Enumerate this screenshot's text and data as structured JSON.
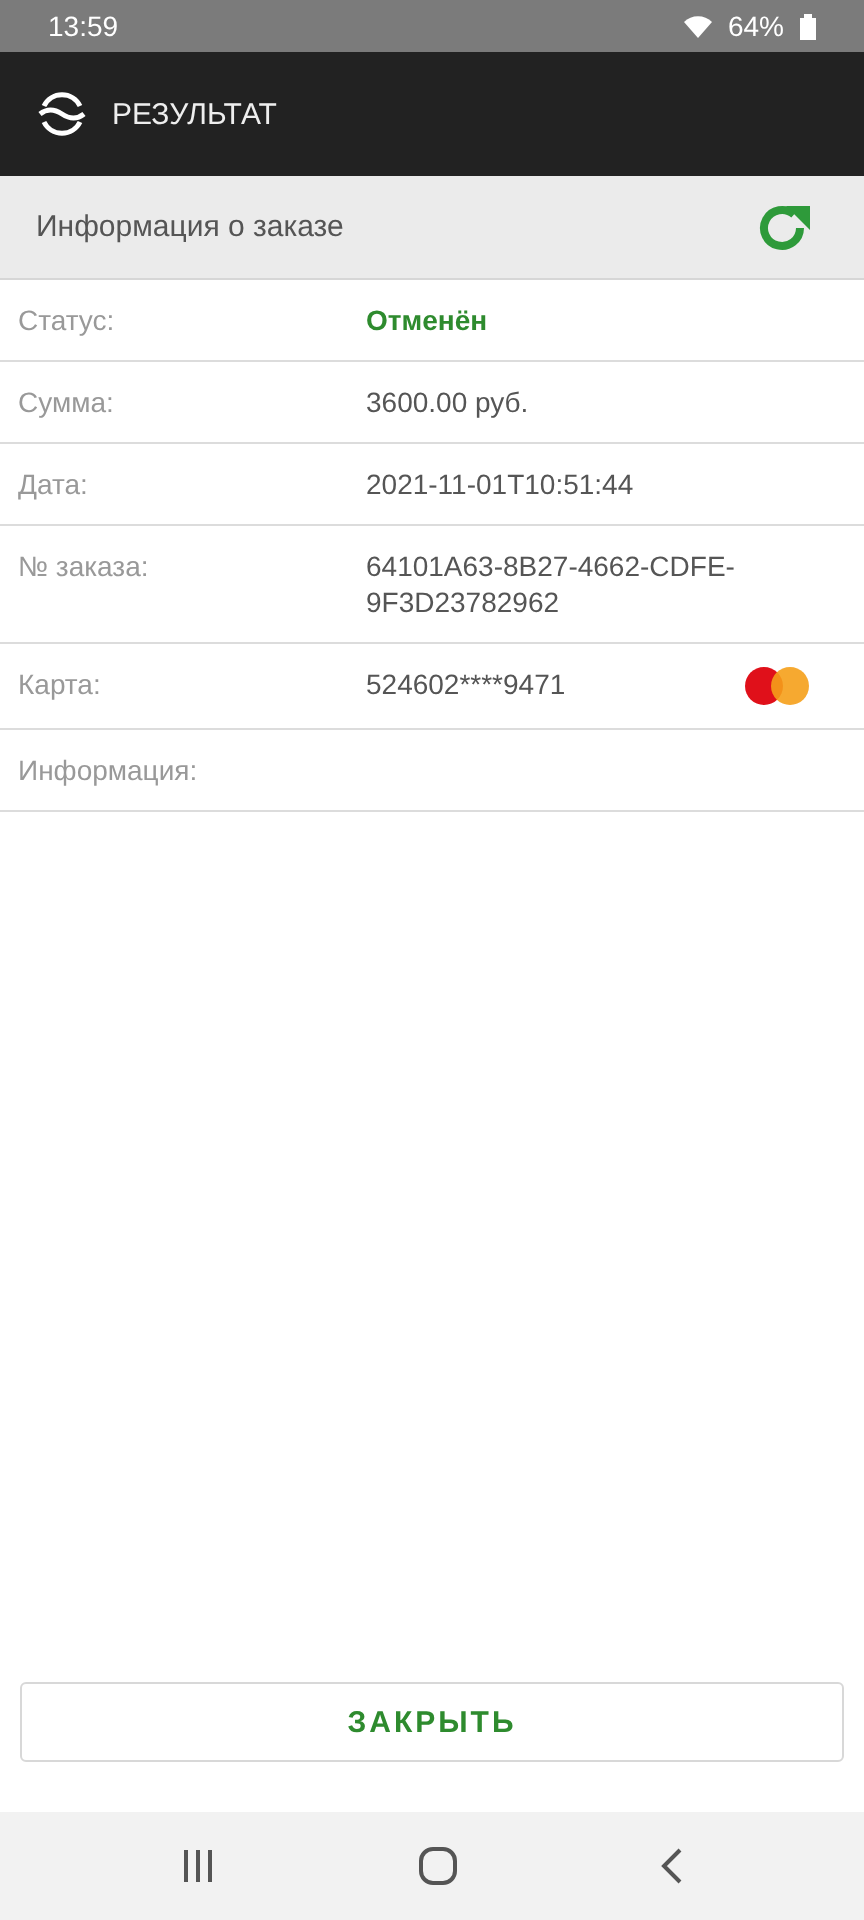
{
  "status_bar": {
    "time": "13:59",
    "battery": "64%"
  },
  "app_bar": {
    "title": "РЕЗУЛЬТАТ"
  },
  "section": {
    "title": "Информация о заказе"
  },
  "rows": [
    {
      "kind": "status",
      "label": "Статус:",
      "value": "Отменён"
    },
    {
      "kind": "text",
      "label": "Сумма:",
      "value": "3600.00 руб."
    },
    {
      "kind": "text",
      "label": "Дата:",
      "value": "2021-11-01T10:51:44"
    },
    {
      "kind": "text",
      "label": "№ заказа:",
      "value": "64101A63-8B27-4662-CDFE-9F3D23782962"
    },
    {
      "kind": "card",
      "label": "Карта:",
      "value": "524602****9471"
    },
    {
      "kind": "text",
      "label": "Информация:"
    }
  ],
  "close_button": "ЗАКРЫТЬ"
}
